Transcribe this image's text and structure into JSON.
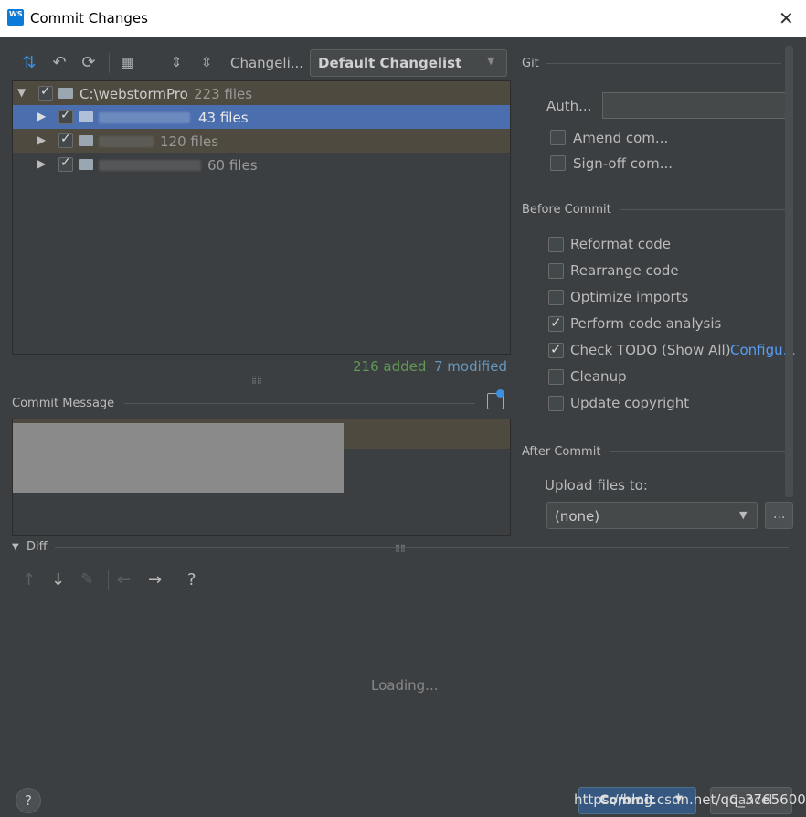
{
  "window": {
    "title": "Commit Changes"
  },
  "toolbar": {
    "changelist_label": "Changeli...",
    "changelist_value": "Default Changelist"
  },
  "tree": {
    "root": {
      "path": "C:\\webstormPro",
      "count": "223 files"
    },
    "children": [
      {
        "count": "43 files"
      },
      {
        "count": "120 files"
      },
      {
        "count": "60 files"
      }
    ]
  },
  "stats": {
    "added": "216 added",
    "modified": "7 modified"
  },
  "commit_message": {
    "label": "Commit Message"
  },
  "git": {
    "title": "Git",
    "author_label": "Auth...",
    "author_value": "",
    "amend": "Amend com...",
    "signoff": "Sign-off com..."
  },
  "before_commit": {
    "title": "Before Commit",
    "options": [
      {
        "label": "Reformat code",
        "checked": false
      },
      {
        "label": "Rearrange code",
        "checked": false
      },
      {
        "label": "Optimize imports",
        "checked": false
      },
      {
        "label": "Perform code analysis",
        "checked": true
      },
      {
        "label": "Check TODO (Show All)",
        "checked": true
      },
      {
        "label": "Cleanup",
        "checked": false
      },
      {
        "label": "Update copyright",
        "checked": false
      }
    ],
    "configure_link": "Configu..."
  },
  "after_commit": {
    "title": "After Commit",
    "upload_label": "Upload files to:",
    "upload_value": "(none)",
    "browse_label": "..."
  },
  "diff": {
    "title": "Diff",
    "loading": "Loading..."
  },
  "footer": {
    "help": "?",
    "commit_label": "Commit",
    "cancel_label": "Cancel",
    "watermark": "https://blog.csdn.net/qq_37656005"
  },
  "colors": {
    "selection": "#4b6eaf",
    "highlight_row": "#4e4a3f",
    "added": "#629755",
    "modified": "#6897bb",
    "link": "#589df6"
  }
}
